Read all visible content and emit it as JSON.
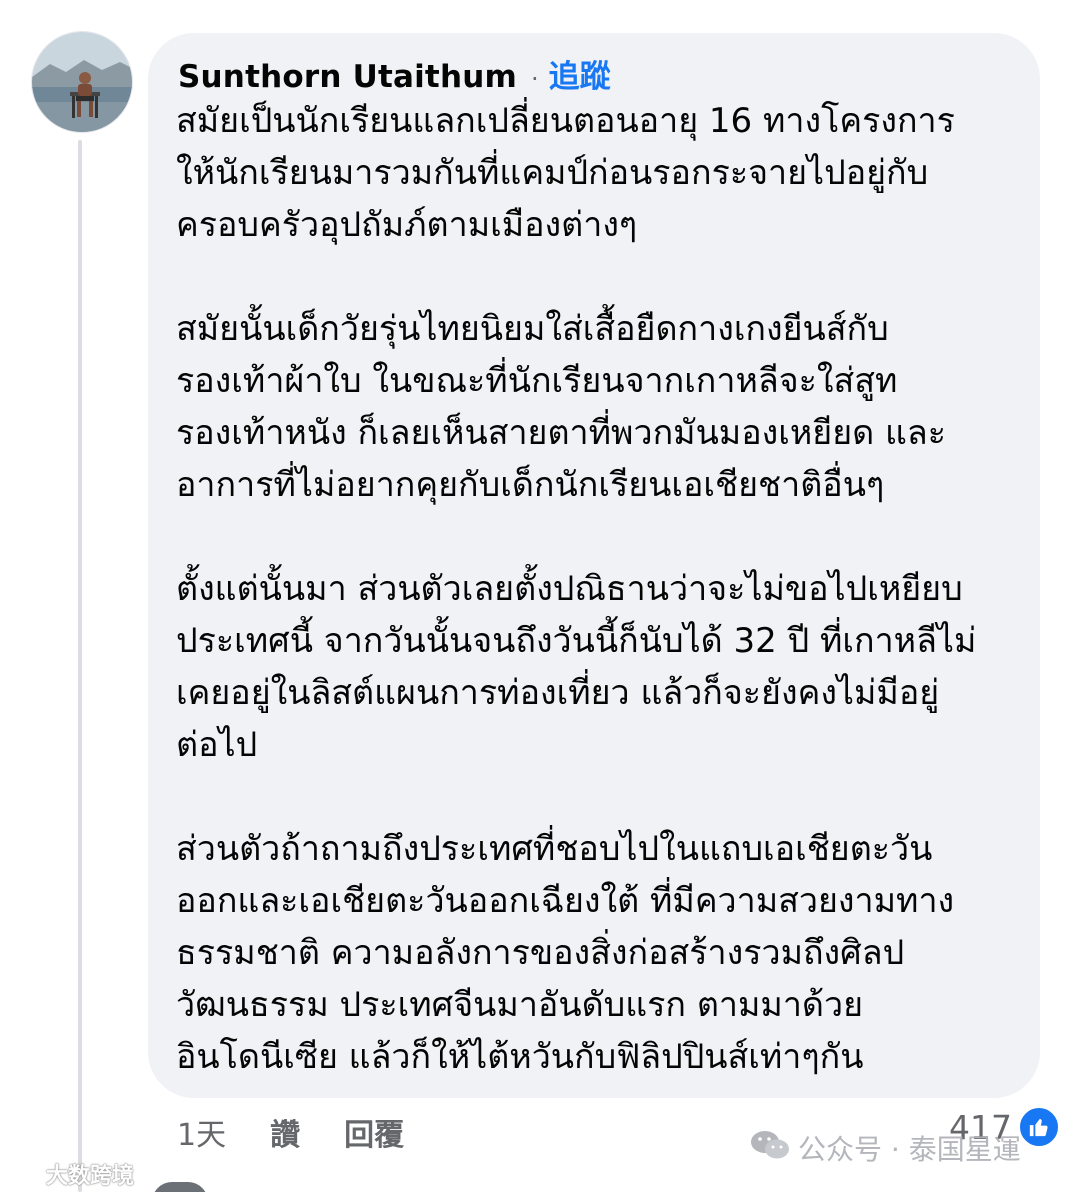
{
  "comment": {
    "author": "Sunthorn Utaithum",
    "separator": "·",
    "follow_label": "追蹤",
    "paragraphs": [
      [
        "สมัยเป็นนักเรียนแลกเปลี่ยนตอนอายุ 16 ทางโครงการ",
        "ให้นักเรียนมารวมกันที่แคมป์ก่อนรอกระจายไปอยู่กับ",
        "ครอบครัวอุปถัมภ์ตามเมืองต่างๆ"
      ],
      [
        "สมัยนั้นเด็กวัยรุ่นไทยนิยมใส่เสื้อยืดกางเกงยีนส์กับ",
        "รองเท้าผ้าใบ ในขณะที่นักเรียนจากเกาหลีจะใส่สูท",
        "รองเท้าหนัง ก็เลยเห็นสายตาที่พวกมันมองเหยียด และ",
        "อาการที่ไม่อยากคุยกับเด็กนักเรียนเอเชียชาติอื่นๆ"
      ],
      [
        "ตั้งแต่นั้นมา ส่วนตัวเลยตั้งปณิธานว่าจะไม่ขอไปเหยียบ",
        "ประเทศนี้ จากวันนั้นจนถึงวันนี้ก็นับได้ 32 ปี ที่เกาหลีไม่",
        "เคยอยู่ในลิสต์แผนการท่องเที่ยว แล้วก็จะยังคงไม่มีอยู่",
        "ต่อไป"
      ],
      [
        "ส่วนตัวถ้าถามถึงประเทศที่ชอบไปในแถบเอเชียตะวัน",
        "ออกและเอเชียตะวันออกเฉียงใต้ ที่มีความสวยงามทาง",
        "ธรรมชาติ ความอลังการของสิ่งก่อสร้างรวมถึงศิลป",
        "วัฒนธรรม ประเทศจีนมาอันดับแรก ตามมาด้วย",
        "อินโดนีเซีย แล้วก็ให้ไต้หวันกับฟิลิปปินส์เท่าๆกัน"
      ]
    ],
    "footer": {
      "time": "1天",
      "like_label": "讚",
      "reply_label": "回覆",
      "reaction_count": "417"
    }
  },
  "watermark": {
    "right_text": "公众号 · 泰国星運",
    "left_text": "大数跨境"
  },
  "colors": {
    "bubble": "#f0f2f5",
    "link_blue": "#1877f2",
    "meta_gray": "#65676b"
  },
  "icons": {
    "avatar": "profile-photo",
    "like": "thumbs-up-icon",
    "watermark": "wechat-icon"
  }
}
